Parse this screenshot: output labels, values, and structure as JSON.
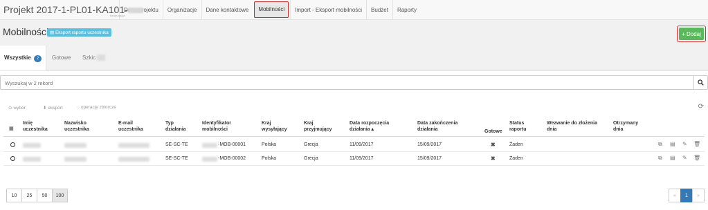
{
  "project": {
    "title": "Projekt 2017-1-PL01-KA101-",
    "subtitle": "kontynuacja"
  },
  "nav": {
    "items": [
      "Dane projektu",
      "Organizacje",
      "Dane kontaktowe",
      "Mobilności",
      "Import - Eksport mobilności",
      "Budżet",
      "Raporty"
    ],
    "active": "Mobilności"
  },
  "header": {
    "title": "Mobilności",
    "export_label": "Eksport raportu uczestnika",
    "add_label": "Dodaj"
  },
  "tabs": {
    "all_label": "Wszystkie",
    "all_count": "2",
    "ready_label": "Gotowe",
    "draft_label": "Szkic"
  },
  "search": {
    "placeholder": "Wyszukaj w 2 rekord"
  },
  "toolbar": {
    "select_label": "wybór",
    "export_label": "eksport",
    "bulk_label": "operacje zbiorcze"
  },
  "columns": {
    "first_name": [
      "Imię",
      "uczestnika"
    ],
    "last_name": [
      "Nazwisko",
      "uczestnika"
    ],
    "email": [
      "E-mail",
      "uczestnika"
    ],
    "type": [
      "Typ",
      "działania"
    ],
    "mobility_id": [
      "Identyfikator",
      "mobilności"
    ],
    "sending": [
      "Kraj",
      "wysyłający"
    ],
    "receiving": [
      "Kraj",
      "przyjmujący"
    ],
    "start": [
      "Data rozpoczęcia",
      "działania ▴"
    ],
    "end": [
      "Data zakończenia",
      "działania"
    ],
    "ready": [
      "Gotowe",
      ""
    ],
    "report_status": [
      "Status",
      "raportu"
    ],
    "due": [
      "Wezwanie do złożenia",
      "dnia"
    ],
    "received": [
      "Otrzymany",
      "dnia"
    ]
  },
  "rows": [
    {
      "type": "SE-SC-TE",
      "mobility_id": "-MOB-00001",
      "sending": "Polska",
      "receiving": "Grecja",
      "start": "11/09/2017",
      "end": "15/09/2017",
      "status": "Żaden"
    },
    {
      "type": "SE-SC-TE",
      "mobility_id": "-MOB-00002",
      "sending": "Polska",
      "receiving": "Grecja",
      "start": "11/09/2017",
      "end": "15/09/2017",
      "status": "Żaden"
    }
  ],
  "pagination": {
    "sizes": [
      "10",
      "25",
      "50",
      "100"
    ],
    "active_size": "100",
    "prev": "«",
    "page": "1",
    "next": "»"
  }
}
